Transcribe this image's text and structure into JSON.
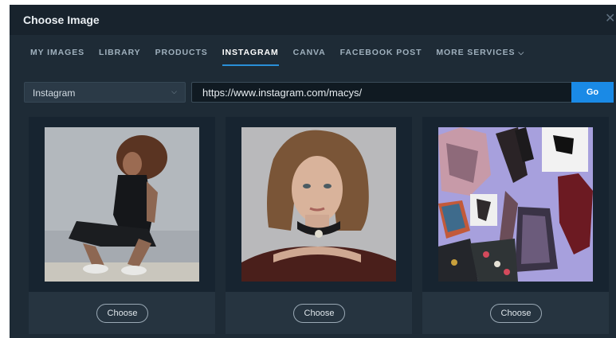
{
  "dialog": {
    "title": "Choose Image"
  },
  "tabs": [
    {
      "label": "MY IMAGES"
    },
    {
      "label": "LIBRARY"
    },
    {
      "label": "PRODUCTS"
    },
    {
      "label": "INSTAGRAM"
    },
    {
      "label": "CANVA"
    },
    {
      "label": "FACEBOOK POST"
    },
    {
      "label": "MORE SERVICES"
    }
  ],
  "source_select": {
    "value": "Instagram"
  },
  "url_input": {
    "value": "https://www.instagram.com/macys/"
  },
  "go_button": {
    "label": "Go"
  },
  "cards": [
    {
      "choose_label": "Choose"
    },
    {
      "choose_label": "Choose"
    },
    {
      "choose_label": "Choose"
    }
  ],
  "colors": {
    "accent": "#1a8ae6",
    "background": "#1e2b36"
  }
}
